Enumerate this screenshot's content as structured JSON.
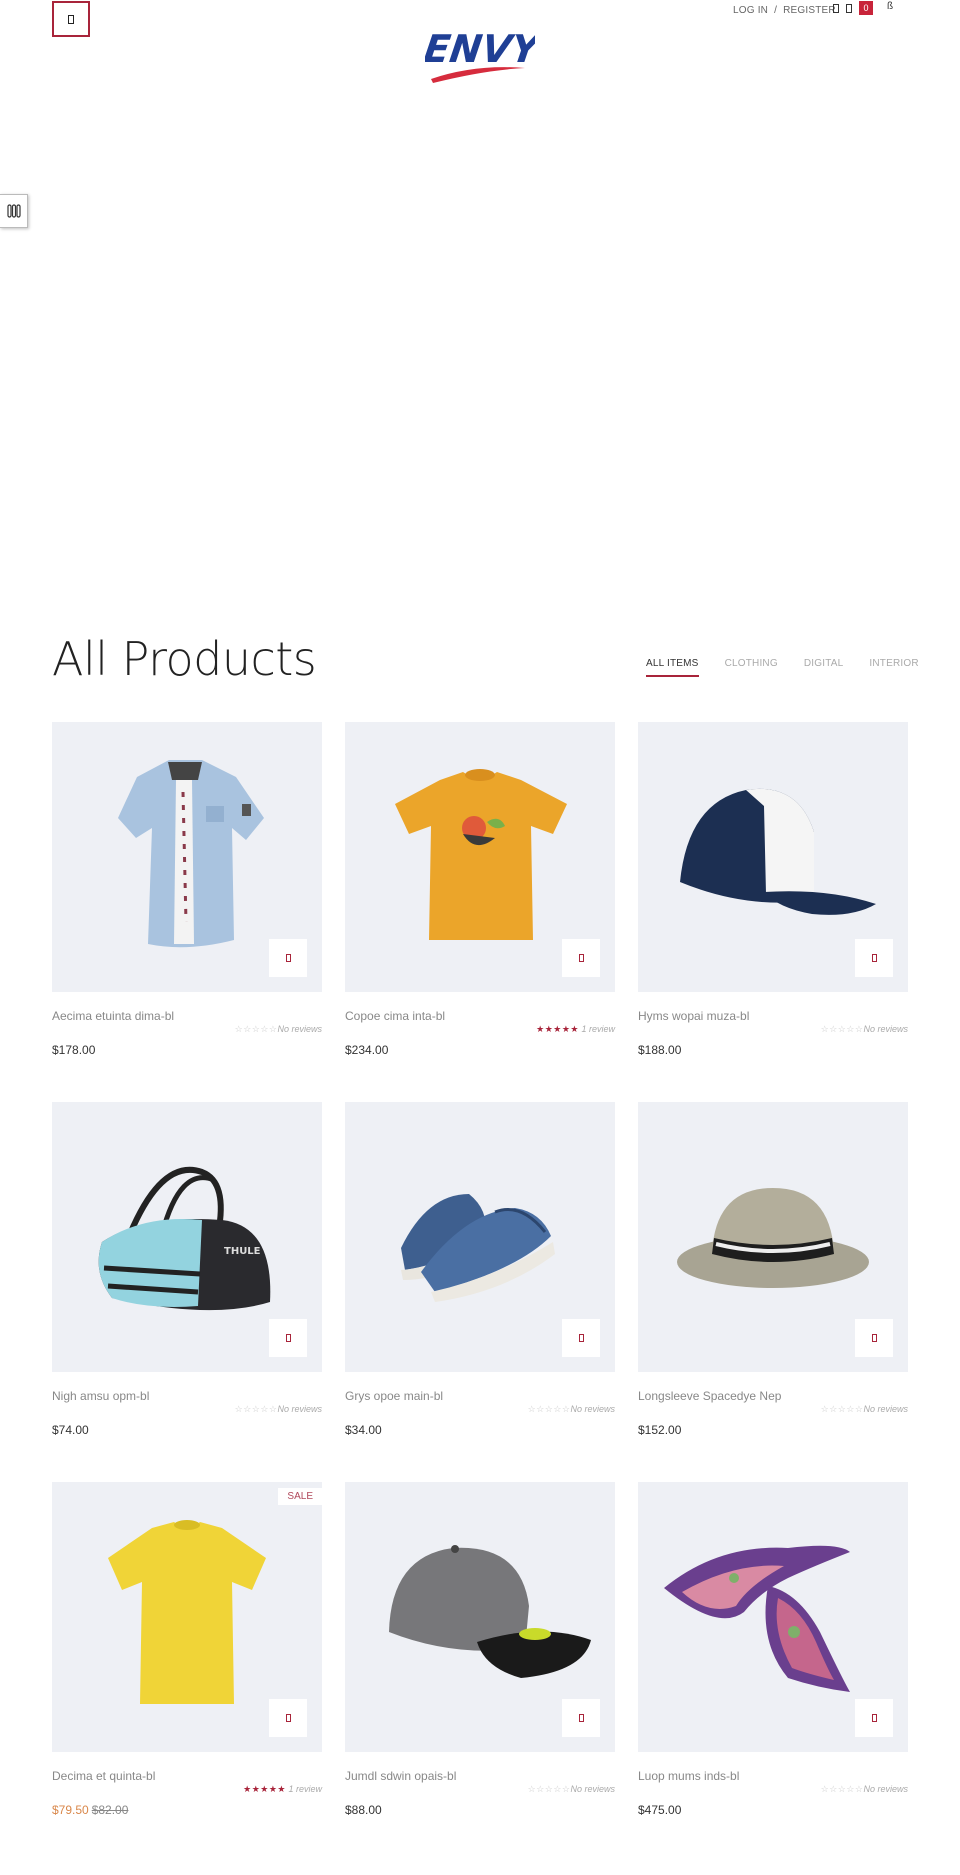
{
  "header": {
    "login": "LOG IN",
    "separator": "/",
    "register": "REGISTER",
    "cart_count": "0",
    "extra_icon": "ß",
    "logo_text": "ENVY"
  },
  "section": {
    "title": "All Products",
    "filters": [
      "ALL ITEMS",
      "CLOTHING",
      "DIGITAL",
      "INTERIOR"
    ],
    "active_filter": "ALL ITEMS"
  },
  "products": [
    {
      "name": "Aecima etuinta dima-bl",
      "rating_stars": "☆☆☆☆☆",
      "rating_text": "No reviews",
      "rated": false,
      "price": "$178.00",
      "image": "denim-shirt"
    },
    {
      "name": "Copoe cima inta-bl",
      "rating_stars": "★★★★★",
      "rating_text": "1 review",
      "rated": true,
      "price": "$234.00",
      "image": "orange-tshirt"
    },
    {
      "name": "Hyms wopai muza-bl",
      "rating_stars": "☆☆☆☆☆",
      "rating_text": "No reviews",
      "rated": false,
      "price": "$188.00",
      "image": "trucker-cap"
    },
    {
      "name": "Nigh amsu opm-bl",
      "rating_stars": "☆☆☆☆☆",
      "rating_text": "No reviews",
      "rated": false,
      "price": "$74.00",
      "image": "duffel-bag",
      "bag_brand": "THULE"
    },
    {
      "name": "Grys opoe main-bl",
      "rating_stars": "☆☆☆☆☆",
      "rating_text": "No reviews",
      "rated": false,
      "price": "$34.00",
      "image": "sneakers"
    },
    {
      "name": "Longsleeve Spacedye Nep",
      "rating_stars": "☆☆☆☆☆",
      "rating_text": "No reviews",
      "rated": false,
      "price": "$152.00",
      "image": "fedora-hat"
    },
    {
      "name": "Decima et quinta-bl",
      "rating_stars": "★★★★★",
      "rating_text": "1 review",
      "rated": true,
      "price": "$79.50",
      "old_price": "$82.00",
      "badge": "SALE",
      "image": "yellow-tshirt"
    },
    {
      "name": "Jumdl sdwin opais-bl",
      "rating_stars": "☆☆☆☆☆",
      "rating_text": "No reviews",
      "rated": false,
      "price": "$88.00",
      "image": "snapback-cap"
    },
    {
      "name": "Luop mums inds-bl",
      "rating_stars": "☆☆☆☆☆",
      "rating_text": "No reviews",
      "rated": false,
      "price": "$475.00",
      "image": "silk-scarf"
    }
  ],
  "colors": {
    "accent": "#a8243a",
    "product_bg": "#eef0f5",
    "logo_blue": "#1f3f95",
    "logo_red": "#d62c3d",
    "sale_price": "#d9874a"
  }
}
